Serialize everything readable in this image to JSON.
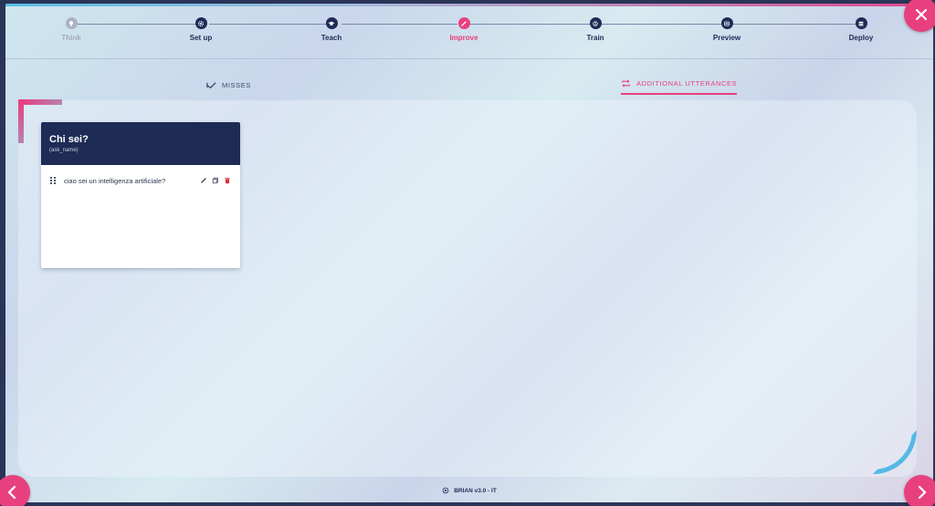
{
  "stepper": {
    "steps": [
      {
        "label": "Think",
        "icon": "bulb-icon",
        "state": "disabled"
      },
      {
        "label": "Set up",
        "icon": "gear-icon",
        "state": "done"
      },
      {
        "label": "Teach",
        "icon": "graduation-cap-icon",
        "state": "done"
      },
      {
        "label": "Improve",
        "icon": "pencil-icon",
        "state": "active"
      },
      {
        "label": "Train",
        "icon": "train-icon",
        "state": "done"
      },
      {
        "label": "Preview",
        "icon": "preview-icon",
        "state": "done"
      },
      {
        "label": "Deploy",
        "icon": "deploy-icon",
        "state": "done"
      }
    ]
  },
  "tabs": {
    "misses": "MISSES",
    "additional": "ADDITIONAL UTTERANCES"
  },
  "card": {
    "title": "Chi sei?",
    "intent": "(ask_name)",
    "utterances": [
      {
        "text": "ciao sei un intelligenza artificiale?"
      }
    ]
  },
  "footer": {
    "version": "BRIAN v3.0 - IT"
  },
  "colors": {
    "accent": "#e8407e",
    "navy": "#1e2b55",
    "cyan": "#55b9e4"
  }
}
